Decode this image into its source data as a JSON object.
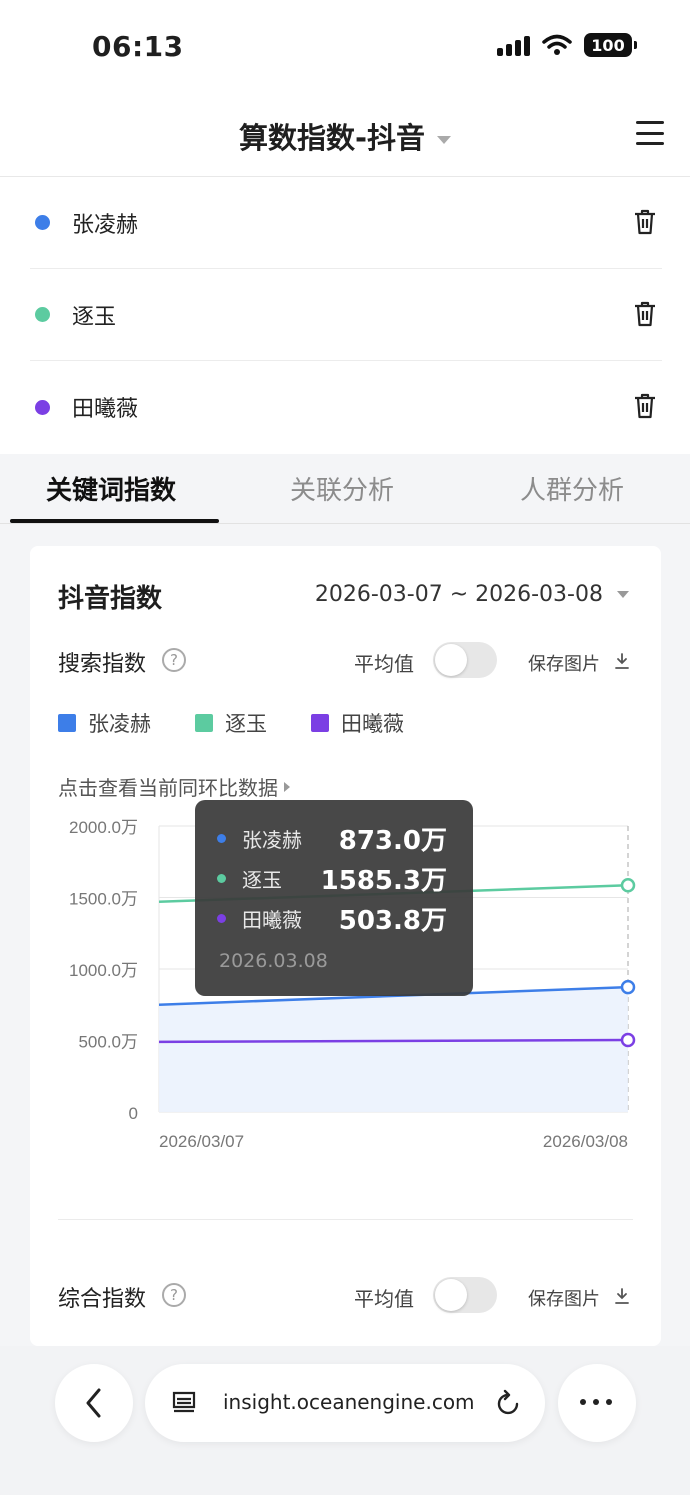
{
  "status_bar": {
    "time": "06:13",
    "battery": "100"
  },
  "nav": {
    "title": "算数指数-抖音"
  },
  "compare_items": [
    {
      "name": "张凌赫",
      "color": "#3d7ee8"
    },
    {
      "name": "逐玉",
      "color": "#5ccba0"
    },
    {
      "name": "田曦薇",
      "color": "#7b3fe4"
    }
  ],
  "tabs": [
    {
      "label": "关键词指数",
      "active": true
    },
    {
      "label": "关联分析",
      "active": false
    },
    {
      "label": "人群分析",
      "active": false
    }
  ],
  "card": {
    "title": "抖音指数",
    "date_range": "2026-03-07 ~ 2026-03-08",
    "search_index": {
      "label": "搜索指数",
      "help": "?"
    },
    "average_label": "平均值",
    "save_label": "保存图片",
    "compare_link": "点击查看当前同环比数据",
    "composite_index": {
      "label": "综合指数",
      "help": "?"
    }
  },
  "chart_data": {
    "type": "line",
    "x": [
      "2026/03/07",
      "2026/03/08"
    ],
    "yticks": [
      "2000.0万",
      "1500.0万",
      "1000.0万",
      "500.0万",
      "0"
    ],
    "ylim": [
      0,
      2000
    ],
    "series": [
      {
        "name": "张凌赫",
        "color": "#3d7ee8",
        "values": [
          750,
          873.0
        ],
        "area": true
      },
      {
        "name": "逐玉",
        "color": "#5ccba0",
        "values": [
          1470,
          1585.3
        ]
      },
      {
        "name": "田曦薇",
        "color": "#7b3fe4",
        "values": [
          490,
          503.8
        ]
      }
    ],
    "tooltip": {
      "date": "2026.03.08",
      "rows": [
        {
          "name": "张凌赫",
          "value": "873.0万",
          "color": "#3d7ee8"
        },
        {
          "name": "逐玉",
          "value": "1585.3万",
          "color": "#5ccba0"
        },
        {
          "name": "田曦薇",
          "value": "503.8万",
          "color": "#7b3fe4"
        }
      ]
    }
  },
  "browser": {
    "url": "insight.oceanengine.com"
  }
}
